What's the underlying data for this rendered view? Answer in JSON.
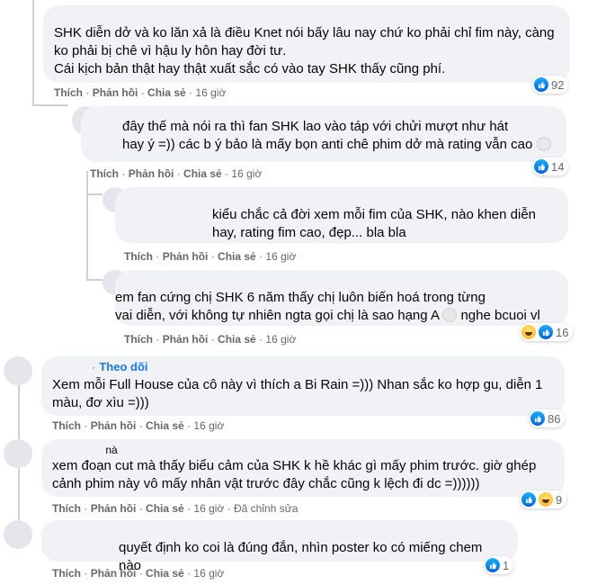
{
  "colors": {
    "link_blue": "#1877f2",
    "like_blue": "#0866ff",
    "bubble_bg": "#f0f2f5",
    "meta_gray": "#65676b"
  },
  "actions": {
    "like": "Thích",
    "reply": "Phản hồi",
    "share": "Chia sẻ",
    "sep": "·"
  },
  "comments": [
    {
      "text": "SHK diễn dở và ko lăn xả là điều Knet nói bấy lâu nay chứ ko phải chỉ fim này, càng\nko phải bị chê vì hậu ly hôn hay đời tư.\nCái kịch bản thật hay thật xuất sắc có vào tay SHK thấy cũng phí.",
      "time": "16 giờ",
      "reactions": {
        "icons": [
          "like-icon"
        ],
        "count": "92"
      }
    },
    {
      "text": "đây thế mà nói ra thì fan SHK lao vào táp với chửi mượt như hát\nhay ý =)) các b ý bảo là mấy bọn anti chê phim dở mà rating vẫn cao",
      "time": "16 giờ",
      "reactions": {
        "icons": [
          "like-icon"
        ],
        "count": "14"
      }
    },
    {
      "text": "kiểu chắc cả đời xem mỗi fim của SHK, nào khen diễn\nhay, rating fim cao, đẹp... bla bla",
      "time": "16 giờ",
      "reactions": null
    },
    {
      "text": "em fan cứng chị SHK 6 năm thấy chị luôn biến hoá trong từng\nvai diễn, với không tự nhiên ngta gọi chị là sao hạng A",
      "text_tail": "nghe bcuoi vl",
      "time": "16 giờ",
      "reactions": {
        "icons": [
          "haha-icon",
          "like-icon"
        ],
        "count": "16"
      }
    },
    {
      "follow": "Theo dõi",
      "text": "Xem mỗi Full House của cô này vì thích a Bi Rain =))) Nhan sắc ko hợp gu, diễn 1\nmàu, đơ xìu =)))",
      "time": "16 giờ",
      "reactions": {
        "icons": [
          "like-icon"
        ],
        "count": "86"
      }
    },
    {
      "name_tail": "nà",
      "text": "xem đoạn cut mà thấy biểu cảm của SHK k hề khác gì mấy phim trước. giờ ghép\ncảnh phim này vô mấy nhân vật trước đây chắc cũng k lệch đi dc =))))))",
      "time": "16 giờ",
      "edited": "Đã chỉnh sửa",
      "reactions": {
        "icons": [
          "like-icon",
          "haha-icon"
        ],
        "count": "9"
      }
    },
    {
      "text": "quyết định ko coi là đúng đắn, nhìn poster ko có miếng chem nào",
      "time": "16 giờ",
      "reactions": {
        "icons": [
          "like-icon"
        ],
        "count": "1"
      }
    }
  ]
}
